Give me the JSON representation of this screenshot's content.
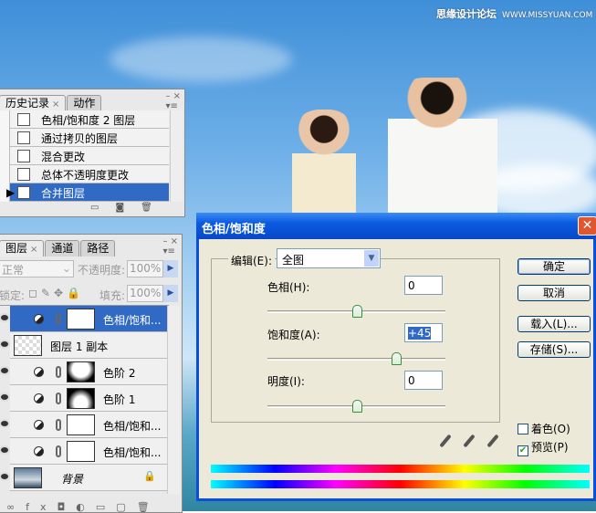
{
  "watermark": {
    "text": "思缘设计论坛",
    "url_text": "WWW.MISSYUAN.COM"
  },
  "history_panel": {
    "tabs": [
      {
        "label": "历史记录",
        "active": true
      },
      {
        "label": "动作",
        "active": false
      }
    ],
    "items": [
      {
        "label": "色相/饱和度 2 图层"
      },
      {
        "label": "通过拷贝的图层"
      },
      {
        "label": "混合更改"
      },
      {
        "label": "总体不透明度更改"
      },
      {
        "label": "合并图层",
        "selected": true
      }
    ]
  },
  "layers_panel": {
    "tabs": [
      {
        "label": "图层",
        "active": true
      },
      {
        "label": "通道"
      },
      {
        "label": "路径"
      }
    ],
    "blend_mode": "正常",
    "opacity_label": "不透明度:",
    "opacity": "100%",
    "lock_label": "锁定:",
    "fill_label": "填充:",
    "fill": "100%",
    "layers": [
      {
        "name": "色相/饱和...",
        "type": "adjustment",
        "selected": true
      },
      {
        "name": "图层 1 副本",
        "type": "pixel"
      },
      {
        "name": "色阶 2",
        "type": "adjustment"
      },
      {
        "name": "色阶 1",
        "type": "adjustment"
      },
      {
        "name": "色相/饱和...",
        "type": "adjustment"
      },
      {
        "name": "色相/饱和...",
        "type": "adjustment"
      },
      {
        "name": "背景",
        "type": "background",
        "locked": true
      }
    ]
  },
  "dialog": {
    "title": "色相/饱和度",
    "edit_label": "编辑(E):",
    "edit_value": "全图",
    "hue": {
      "label": "色相(H):",
      "value": "0",
      "range": [
        -180,
        180
      ]
    },
    "saturation": {
      "label": "饱和度(A):",
      "value": "+45",
      "range": [
        -100,
        100
      ]
    },
    "lightness": {
      "label": "明度(I):",
      "value": "0",
      "range": [
        -100,
        100
      ]
    },
    "buttons": {
      "ok": "确定",
      "cancel": "取消",
      "load": "载入(L)...",
      "save": "存储(S)..."
    },
    "colorize": {
      "label": "着色(O)",
      "checked": false
    },
    "preview": {
      "label": "预览(P)",
      "checked": true
    },
    "accent": "#0a5ae0"
  }
}
